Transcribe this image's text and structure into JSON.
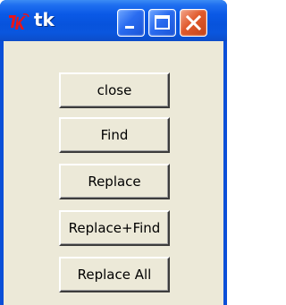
{
  "window": {
    "title": "tk"
  },
  "caption_buttons": {
    "minimize_icon": "minimize-icon",
    "maximize_icon": "maximize-icon",
    "close_icon": "close-icon"
  },
  "buttons": [
    {
      "label": "close"
    },
    {
      "label": "Find"
    },
    {
      "label": "Replace"
    },
    {
      "label": "Replace+Find"
    },
    {
      "label": "Replace All"
    }
  ],
  "colors": {
    "titlebar": "#0a59e6",
    "client_background": "#ece9d8",
    "close_button": "#e15a2c"
  }
}
